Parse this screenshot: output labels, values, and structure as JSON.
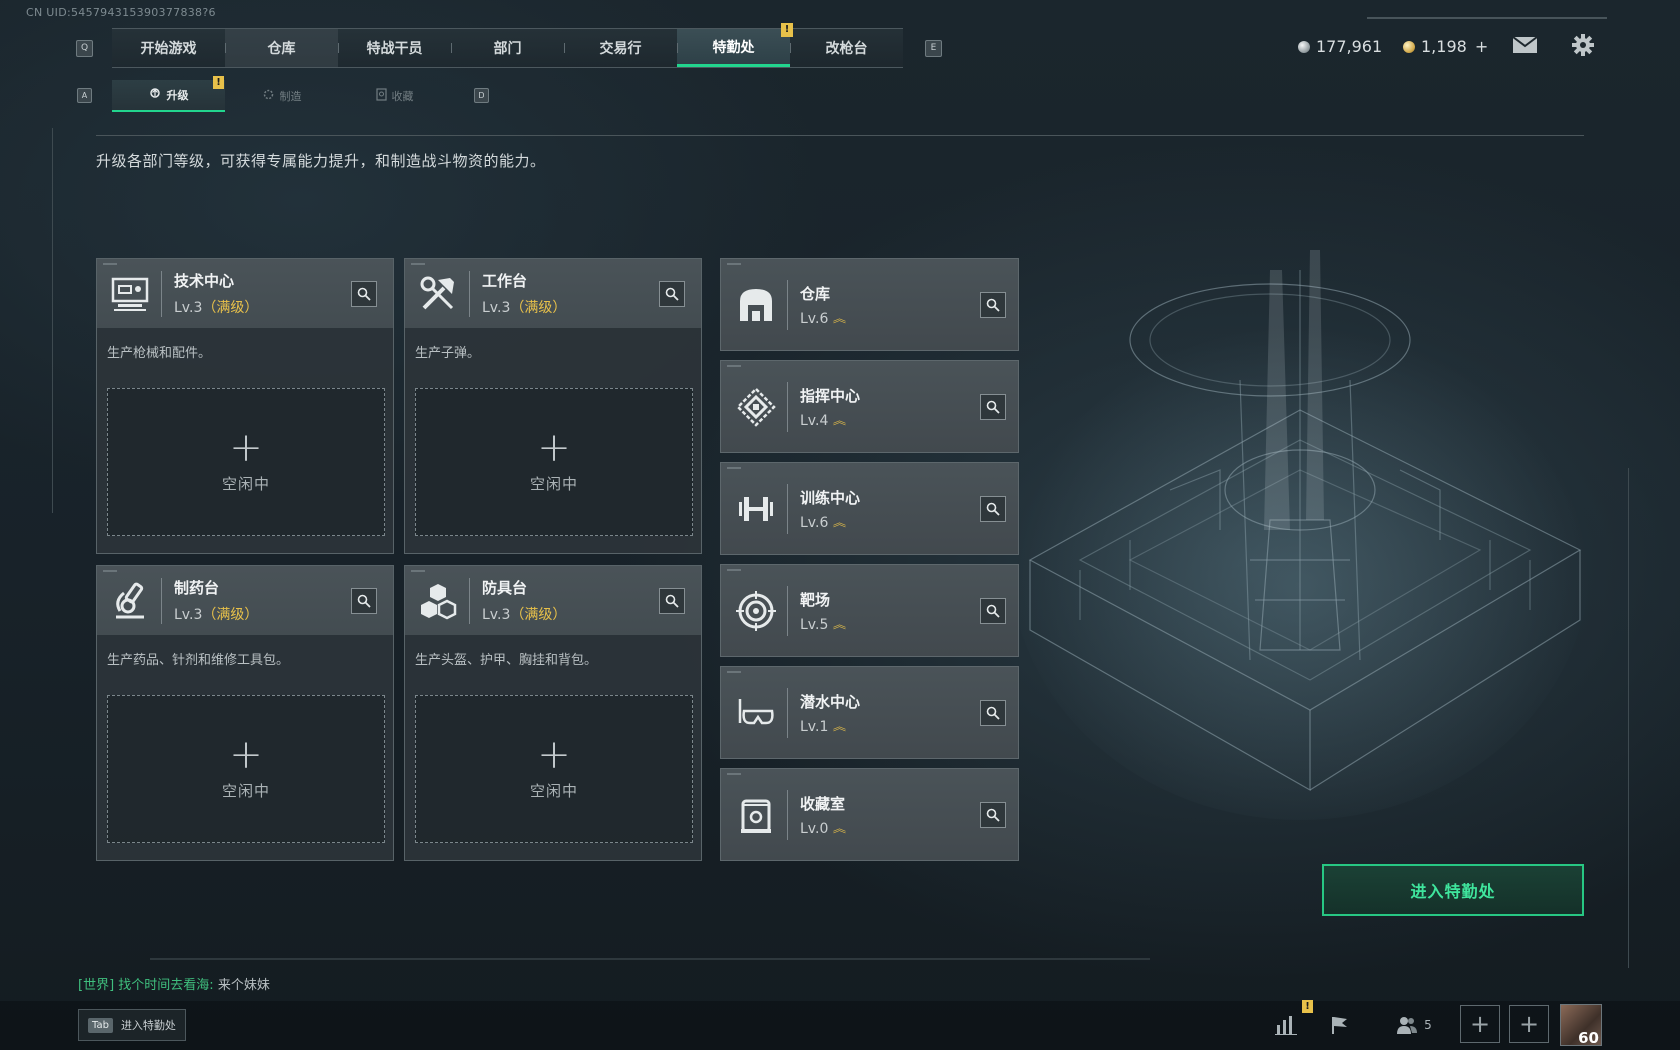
{
  "uid_label": "CN UID:545794315390377838?6",
  "nav": {
    "key_left": "Q",
    "key_right": "E",
    "tabs": [
      {
        "label": "开始游戏"
      },
      {
        "label": "仓库"
      },
      {
        "label": "特战干员"
      },
      {
        "label": "部门"
      },
      {
        "label": "交易行"
      },
      {
        "label": "特勤处",
        "active": true,
        "badge": "!"
      },
      {
        "label": "改枪台"
      }
    ]
  },
  "currency": {
    "silver": "177,961",
    "gold": "1,198",
    "gold_add": "+"
  },
  "subnav": {
    "key_left": "A",
    "key_right": "D",
    "tabs": [
      {
        "label": "升级",
        "active": true,
        "badge": "!"
      },
      {
        "label": "制造"
      },
      {
        "label": "收藏"
      }
    ]
  },
  "description": "升级各部门等级，可获得专属能力提升，和制造战斗物资的能力。",
  "production": [
    {
      "name": "技术中心",
      "level": "Lv.3",
      "status": "（满级）",
      "desc": "生产枪械和配件。",
      "slot": "空闲中",
      "icon": "tech-center-icon"
    },
    {
      "name": "工作台",
      "level": "Lv.3",
      "status": "（满级）",
      "desc": "生产子弹。",
      "slot": "空闲中",
      "icon": "workbench-icon"
    },
    {
      "name": "制药台",
      "level": "Lv.3",
      "status": "（满级）",
      "desc": "生产药品、针剂和维修工具包。",
      "slot": "空闲中",
      "icon": "pharmacy-icon"
    },
    {
      "name": "防具台",
      "level": "Lv.3",
      "status": "（满级）",
      "desc": "生产头盔、护甲、胸挂和背包。",
      "slot": "空闲中",
      "icon": "armor-bench-icon"
    }
  ],
  "departments": [
    {
      "name": "仓库",
      "level": "Lv.6",
      "icon": "warehouse-icon"
    },
    {
      "name": "指挥中心",
      "level": "Lv.4",
      "icon": "command-center-icon"
    },
    {
      "name": "训练中心",
      "level": "Lv.6",
      "icon": "training-center-icon"
    },
    {
      "name": "靶场",
      "level": "Lv.5",
      "icon": "shooting-range-icon"
    },
    {
      "name": "潜水中心",
      "level": "Lv.1",
      "icon": "diving-center-icon"
    },
    {
      "name": "收藏室",
      "level": "Lv.0",
      "icon": "collection-room-icon"
    }
  ],
  "enter_button": "进入特勤处",
  "chat": {
    "channel": "[世界]",
    "user": "找个时间去看海:",
    "message": "来个妹妹"
  },
  "bottom": {
    "tab_key": "Tab",
    "tab_label": "进入特勤处",
    "stats_badge": "!",
    "friends_count": "5",
    "player_level": "60"
  },
  "colors": {
    "accent": "#22d58e",
    "badge": "#e8c14a",
    "max_level": "#e8c14a"
  }
}
